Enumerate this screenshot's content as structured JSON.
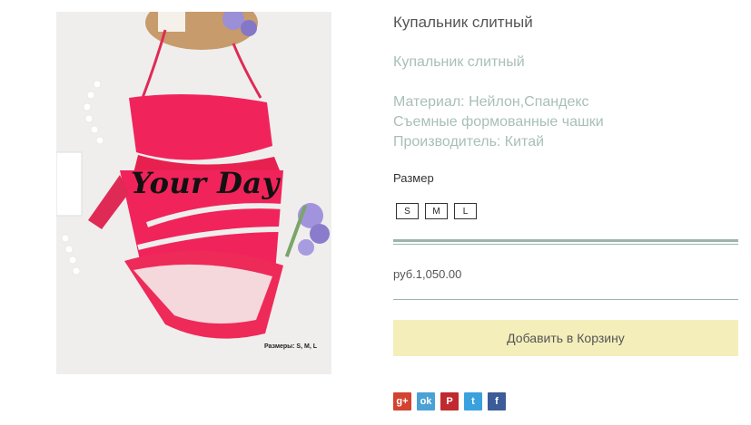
{
  "product": {
    "photo_caption": "Размеры: S, M, L",
    "photo_brand": "Your Day",
    "title": "Купальник слитный",
    "subtitle": "Купальник слитный",
    "description": [
      "Материал: Нейлон,Спандекс",
      "Съемные формованные чашки",
      "Производитель: Китай"
    ],
    "size_label": "Размер",
    "sizes": [
      "S",
      "M",
      "L"
    ],
    "price": "руб.1,050.00",
    "add_to_cart": "Добавить в Корзину"
  },
  "share": [
    {
      "name": "google-plus",
      "glyph": "g+",
      "color": "#d3432f"
    },
    {
      "name": "odnoklassniki",
      "glyph": "ok",
      "color": "#4aa1d6"
    },
    {
      "name": "pinterest",
      "glyph": "P",
      "color": "#c02a2f"
    },
    {
      "name": "twitter",
      "glyph": "t",
      "color": "#3aa1df"
    },
    {
      "name": "facebook",
      "glyph": "f",
      "color": "#3b5b99"
    }
  ]
}
